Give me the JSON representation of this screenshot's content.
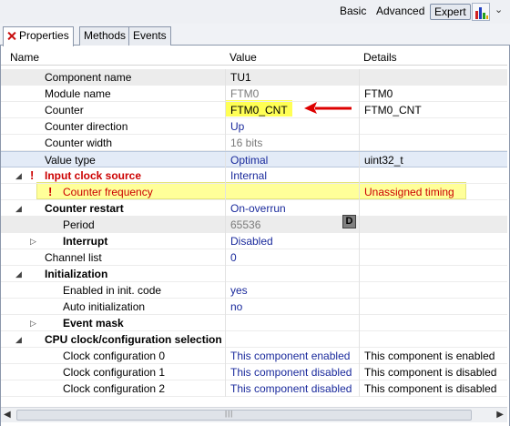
{
  "toolbar": {
    "basic_label": "Basic",
    "advanced_label": "Advanced",
    "expert_label": "Expert",
    "chart_icon": "bar-chart-icon",
    "menu_icon": "chevron-down-icon"
  },
  "tabs": [
    {
      "label": "Properties",
      "active": true
    },
    {
      "label": "Methods"
    },
    {
      "label": "Events"
    }
  ],
  "columns": {
    "name": "Name",
    "value": "Value",
    "details": "Details"
  },
  "rows": [
    {
      "name": "Component name",
      "value": "TU1",
      "details": ""
    },
    {
      "name": "Module name",
      "value": "FTM0",
      "details": "FTM0"
    },
    {
      "name": "Counter",
      "value": "FTM0_CNT",
      "details": "FTM0_CNT"
    },
    {
      "name": "Counter direction",
      "value": "Up",
      "details": ""
    },
    {
      "name": "Counter width",
      "value": "16 bits",
      "details": ""
    },
    {
      "name": "Value type",
      "value": "Optimal",
      "details": "uint32_t"
    },
    {
      "name": "Input clock source",
      "value": "Internal",
      "details": ""
    },
    {
      "name": "Counter frequency",
      "value": "",
      "details": "Unassigned timing"
    },
    {
      "name": "Counter restart",
      "value": "On-overrun",
      "details": ""
    },
    {
      "name": "Period",
      "value": "65536",
      "details": "",
      "button": "D"
    },
    {
      "name": "Interrupt",
      "value": "Disabled",
      "details": ""
    },
    {
      "name": "Channel list",
      "value": "0",
      "details": ""
    },
    {
      "name": "Initialization",
      "value": "",
      "details": ""
    },
    {
      "name": "Enabled in init. code",
      "value": "yes",
      "details": ""
    },
    {
      "name": "Auto initialization",
      "value": "no",
      "details": ""
    },
    {
      "name": "Event mask",
      "value": "",
      "details": ""
    },
    {
      "name": "CPU clock/configuration selection",
      "value": "",
      "details": ""
    },
    {
      "name": "Clock configuration 0",
      "value": "This component enabled",
      "details": "This component is enabled"
    },
    {
      "name": "Clock configuration 1",
      "value": "This component disabled",
      "details": "This component is disabled"
    },
    {
      "name": "Clock configuration 2",
      "value": "This component disabled",
      "details": "This component is disabled"
    }
  ],
  "colors": {
    "highlight": "#ffff55",
    "highlight_row": "#ffff99",
    "error": "#cc0000",
    "value_blue": "#1a2a9c",
    "arrow": "#dd0000"
  }
}
